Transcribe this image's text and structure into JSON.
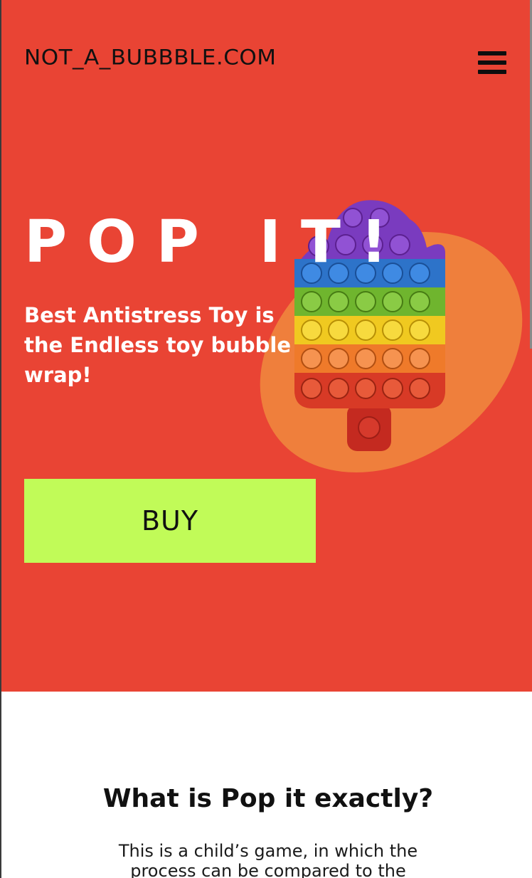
{
  "header": {
    "logo": "NOT_A_BUBBBLE.COM",
    "menu_icon": "hamburger-menu-icon"
  },
  "hero": {
    "title": "POP IT!",
    "subtitle": "Best Antistress Toy is the Endless toy bubble wrap!",
    "buy_label": "BUY",
    "toy_image": "rainbow-popsicle-pop-it-icon"
  },
  "about": {
    "title": "What is Pop it exactly?",
    "text": "This is a child’s game, in which the process can be compared to the"
  },
  "colors": {
    "hero_bg": "#e94434",
    "blob": "#ef7f3c",
    "buy_button": "#c1fb58",
    "title_text": "#ffffff",
    "dark_text": "#111111"
  }
}
